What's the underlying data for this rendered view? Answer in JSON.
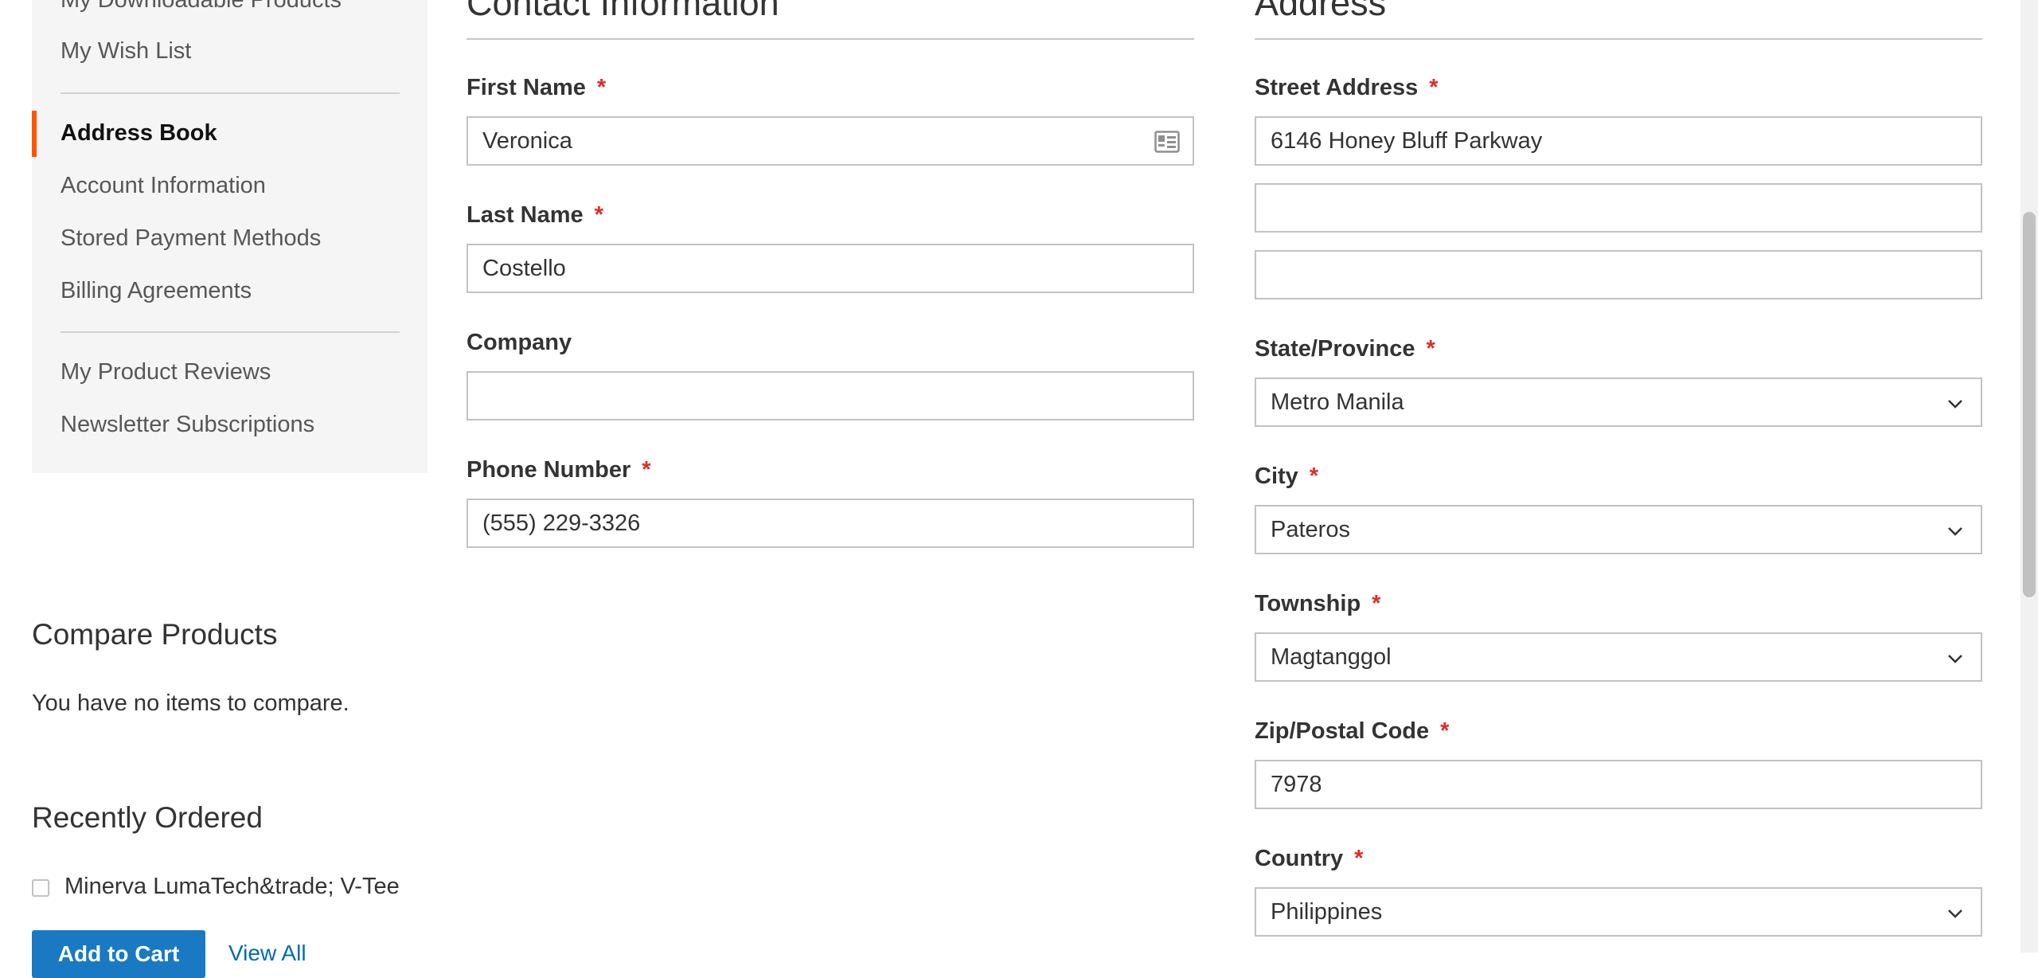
{
  "sidebar": {
    "items_top": [
      "My Downloadable Products",
      "My Wish List"
    ],
    "current": "Address Book",
    "items_mid": [
      "Account Information",
      "Stored Payment Methods",
      "Billing Agreements"
    ],
    "items_bottom": [
      "My Product Reviews",
      "Newsletter Subscriptions"
    ]
  },
  "compare": {
    "title": "Compare Products",
    "empty_text": "You have no items to compare."
  },
  "recently_ordered": {
    "title": "Recently Ordered",
    "item": "Minerva LumaTech&trade; V-Tee",
    "add_to_cart": "Add to Cart",
    "view_all": "View All"
  },
  "contact": {
    "legend": "Contact Information",
    "first_name_label": "First Name",
    "first_name_value": "Veronica",
    "last_name_label": "Last Name",
    "last_name_value": "Costello",
    "company_label": "Company",
    "company_value": "",
    "phone_label": "Phone Number",
    "phone_value": "(555) 229-3326"
  },
  "address": {
    "legend": "Address",
    "street_label": "Street Address",
    "street_value_1": "6146 Honey Bluff Parkway",
    "street_value_2": "",
    "street_value_3": "",
    "state_label": "State/Province",
    "state_value": "Metro Manila",
    "city_label": "City",
    "city_value": "Pateros",
    "township_label": "Township",
    "township_value": "Magtanggol",
    "zip_label": "Zip/Postal Code",
    "zip_value": "7978",
    "country_label": "Country",
    "country_value": "Philippines"
  },
  "required_mark": "*",
  "colors": {
    "accent_current": "#ff5501",
    "required": "#e02b27",
    "primary_button": "#1979c3",
    "link": "#006bb4"
  },
  "icons": {
    "contact_card": "contact-card-icon",
    "select_arrow": "chevron-down-icon"
  }
}
